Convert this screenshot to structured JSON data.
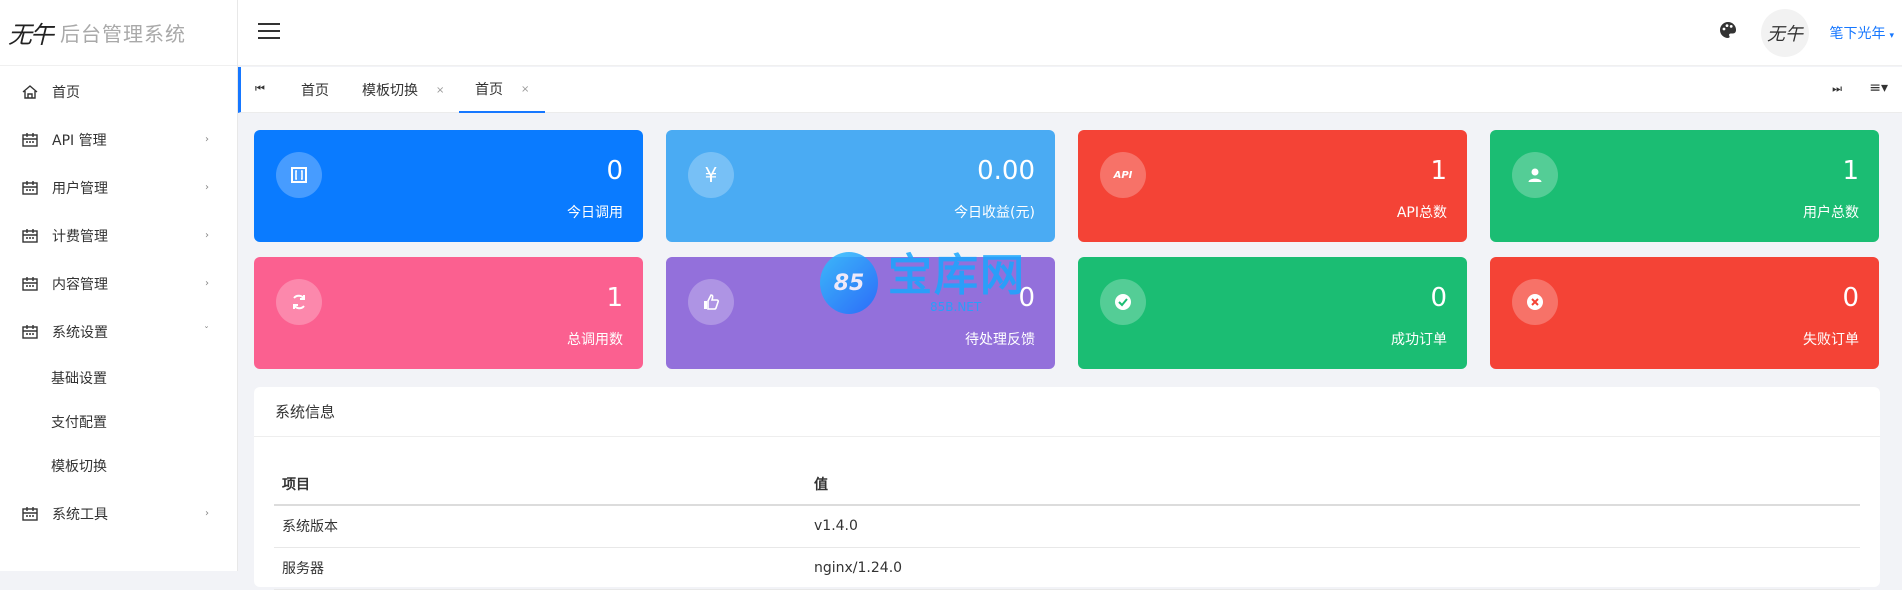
{
  "brand": {
    "logo_mark": "无午",
    "title": "后台管理系统"
  },
  "sidebar": {
    "items": [
      {
        "label": "首页",
        "icon": "home-icon",
        "has_arrow": false
      },
      {
        "label": "API 管理",
        "icon": "calendar-icon",
        "has_arrow": true,
        "arrow": "›"
      },
      {
        "label": "用户管理",
        "icon": "calendar-icon",
        "has_arrow": true,
        "arrow": "›"
      },
      {
        "label": "计费管理",
        "icon": "calendar-icon",
        "has_arrow": true,
        "arrow": "›"
      },
      {
        "label": "内容管理",
        "icon": "calendar-icon",
        "has_arrow": true,
        "arrow": "›"
      },
      {
        "label": "系统设置",
        "icon": "calendar-icon",
        "has_arrow": true,
        "arrow": "ˇ",
        "expanded": true
      },
      {
        "label": "系统工具",
        "icon": "calendar-icon",
        "has_arrow": true,
        "arrow": "›"
      }
    ],
    "submenu": [
      "基础设置",
      "支付配置",
      "模板切换"
    ]
  },
  "header": {
    "avatar_text": "无午",
    "username": "笔下光年",
    "caret": "▾"
  },
  "tabs": {
    "first_icon": "⏮",
    "last_icon": "⏭",
    "menu_icon": "≡▾",
    "items": [
      {
        "label": "首页",
        "closable": false,
        "active": false
      },
      {
        "label": "模板切换",
        "closable": true,
        "active": false,
        "close": "×"
      },
      {
        "label": "首页",
        "closable": true,
        "active": true,
        "close": "×"
      }
    ]
  },
  "cards": [
    {
      "value": "0",
      "label": "今日调用",
      "icon": "bracket-icon",
      "color": "#0a7bff"
    },
    {
      "value": "0.00",
      "label": "今日收益(元)",
      "icon": "yen-icon",
      "color": "#4aabf3"
    },
    {
      "value": "1",
      "label": "API总数",
      "icon": "api-icon",
      "color": "#f44336",
      "icon_text": "API"
    },
    {
      "value": "1",
      "label": "用户总数",
      "icon": "user-icon",
      "color": "#1bbd73"
    },
    {
      "value": "1",
      "label": "总调用数",
      "icon": "refresh-icon",
      "color": "#fb6090"
    },
    {
      "value": "0",
      "label": "待处理反馈",
      "icon": "thumbs-up-icon",
      "color": "#9370db"
    },
    {
      "value": "0",
      "label": "成功订单",
      "icon": "check-circle-icon",
      "color": "#1bbd73"
    },
    {
      "value": "0",
      "label": "失败订单",
      "icon": "x-circle-icon",
      "color": "#f44336"
    }
  ],
  "sysinfo": {
    "title": "系统信息",
    "columns": [
      "项目",
      "值"
    ],
    "rows": [
      [
        "系统版本",
        "v1.4.0"
      ],
      [
        "服务器",
        "nginx/1.24.0"
      ]
    ]
  },
  "watermark": {
    "circle_text": "85",
    "text": "宝库网",
    "sub": "85B.NET"
  }
}
